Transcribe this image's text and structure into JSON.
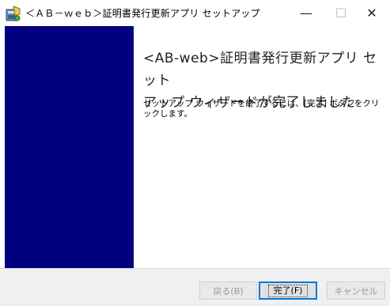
{
  "window": {
    "title": "＜ＡＢ－ｗｅｂ＞証明書発行更新アプリ セットアップ",
    "minimize_glyph": "—",
    "maximize_glyph": "☐",
    "close_glyph": "✕"
  },
  "content": {
    "heading_line1": "<AB-web>証明書発行更新アプリ セット",
    "heading_line2": "アップ ウィザードが完了しました",
    "description": "セットアップ ウィザードを終了するには、[完了] ボタンをクリックします。"
  },
  "buttons": {
    "back_label": "戻る(B)",
    "finish_label": "完了(F)",
    "cancel_label": "キャンセル"
  },
  "colors": {
    "banner": "#00007f",
    "focus_border": "#0078d7"
  },
  "icons": {
    "app": "installer-icon"
  }
}
